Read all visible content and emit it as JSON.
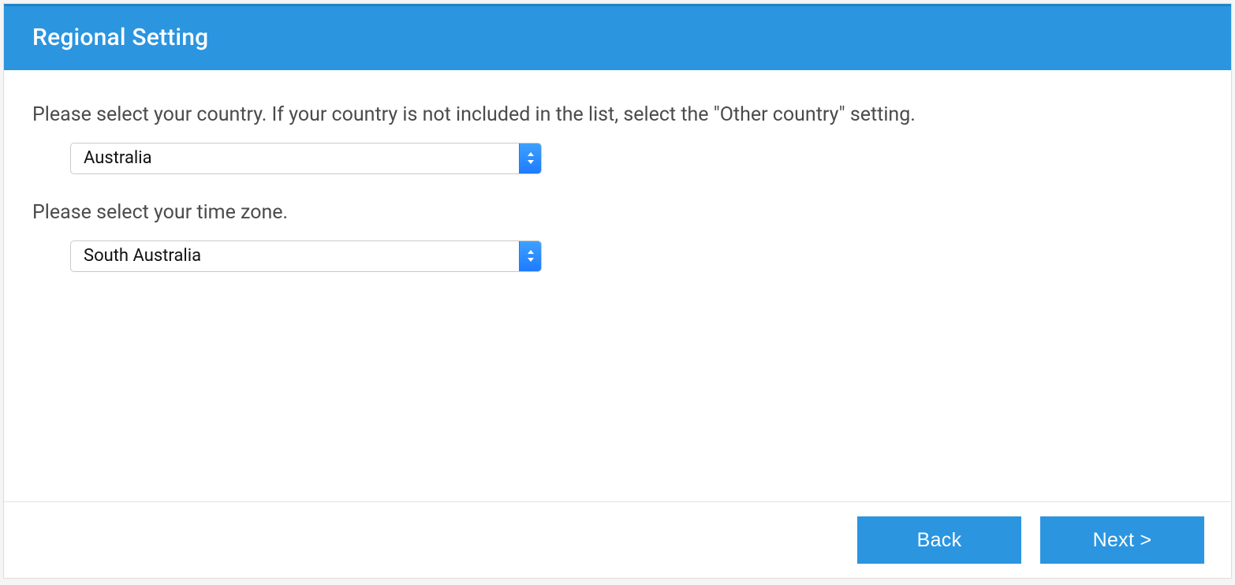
{
  "header": {
    "title": "Regional Setting"
  },
  "body": {
    "country": {
      "instruction": "Please select your country. If your country is not included in the list, select the \"Other country\" setting.",
      "value": "Australia"
    },
    "timezone": {
      "instruction": "Please select your time zone.",
      "value": "South Australia"
    }
  },
  "footer": {
    "back_label": "Back",
    "next_label": "Next >"
  }
}
